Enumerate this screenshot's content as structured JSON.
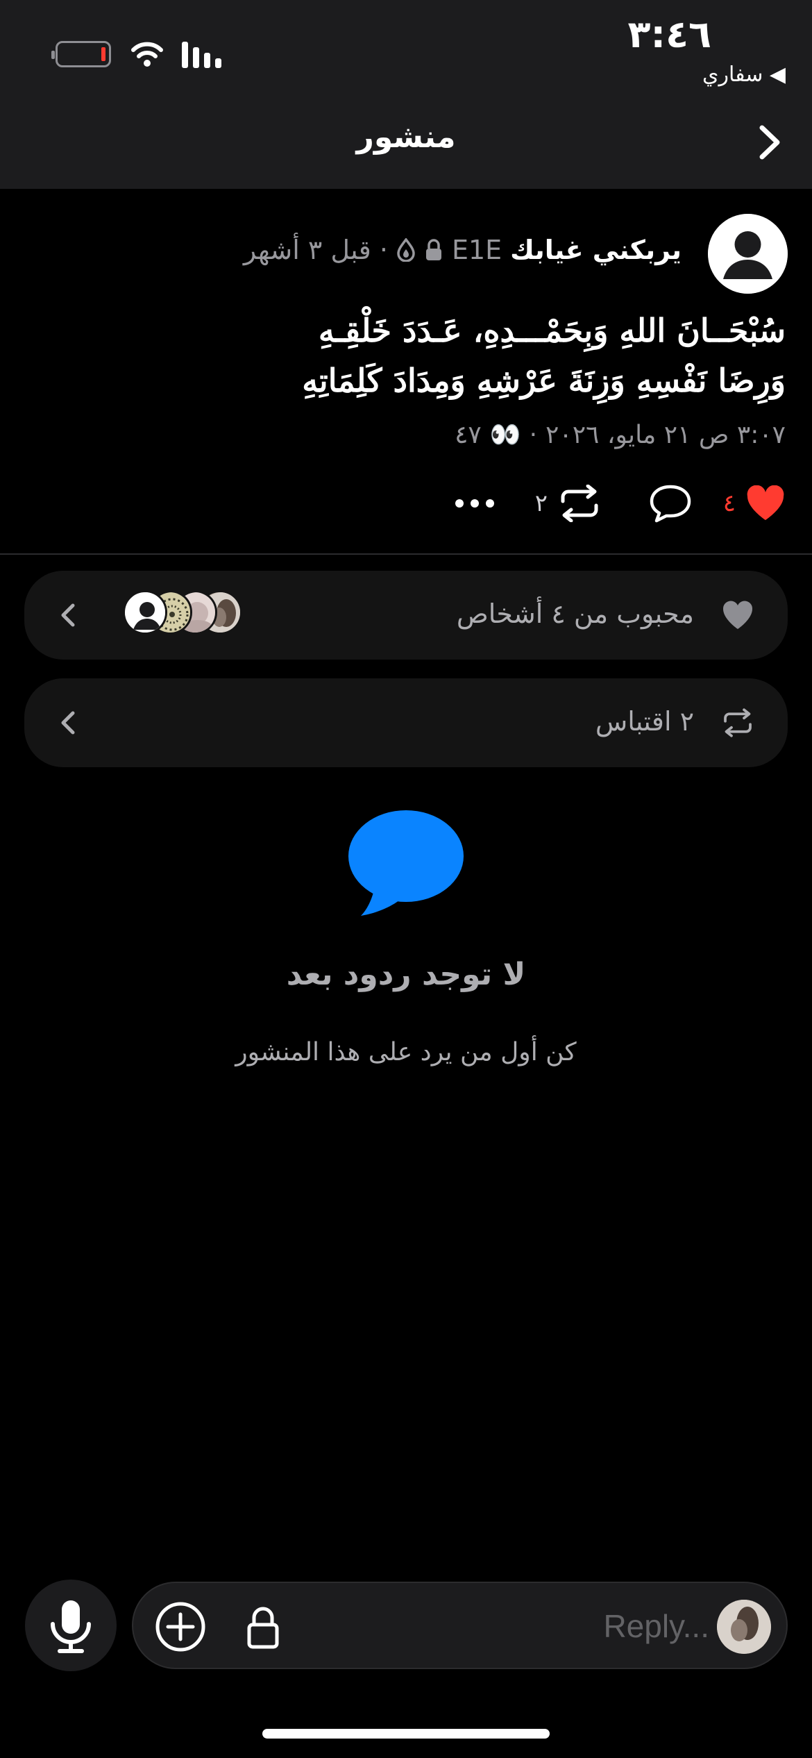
{
  "status_bar": {
    "time": "٣:٤٦",
    "back_app": "◀ سفاري",
    "icons": [
      "battery-icon",
      "wifi-icon",
      "signal-icon"
    ]
  },
  "header": {
    "title": "منشور",
    "back_icon": "chevron-right-icon"
  },
  "post": {
    "author_name": "يربكني غيابك",
    "handle": "E1E",
    "age": "· قبل ٣ أشهر",
    "body_lines": [
      "سُبْحَــانَ اللهِ وَبِحَمْـــدِهِ، عَـدَدَ خَلْقِـهِ",
      "وَرِضَا نَفْسِهِ وَزِنَةَ عَرْشِهِ وَمِدَادَ كَلِمَاتِهِ"
    ],
    "timestamp": "٣:٠٧ ص ٢١ مايو، ٢٠٢٦",
    "views_sep": "·",
    "views": "٤٧",
    "likes_count": "٤",
    "reposts_count": "٢"
  },
  "likes_card": {
    "label": "محبوب من ٤ أشخاص",
    "icon": "heart-icon"
  },
  "quotes_card": {
    "label": "٢ اقتباس",
    "icon": "repost-icon"
  },
  "empty_state": {
    "icon": "message-bubble-icon",
    "title": "لا توجد ردود بعد",
    "subtitle": "كن أول من يرد على هذا المنشور"
  },
  "composer": {
    "placeholder": "Reply..."
  },
  "colors": {
    "accent_blue": "#0a84ff",
    "like_red": "#ff3b30",
    "background": "#000000",
    "header_bg": "#1c1c1e"
  }
}
